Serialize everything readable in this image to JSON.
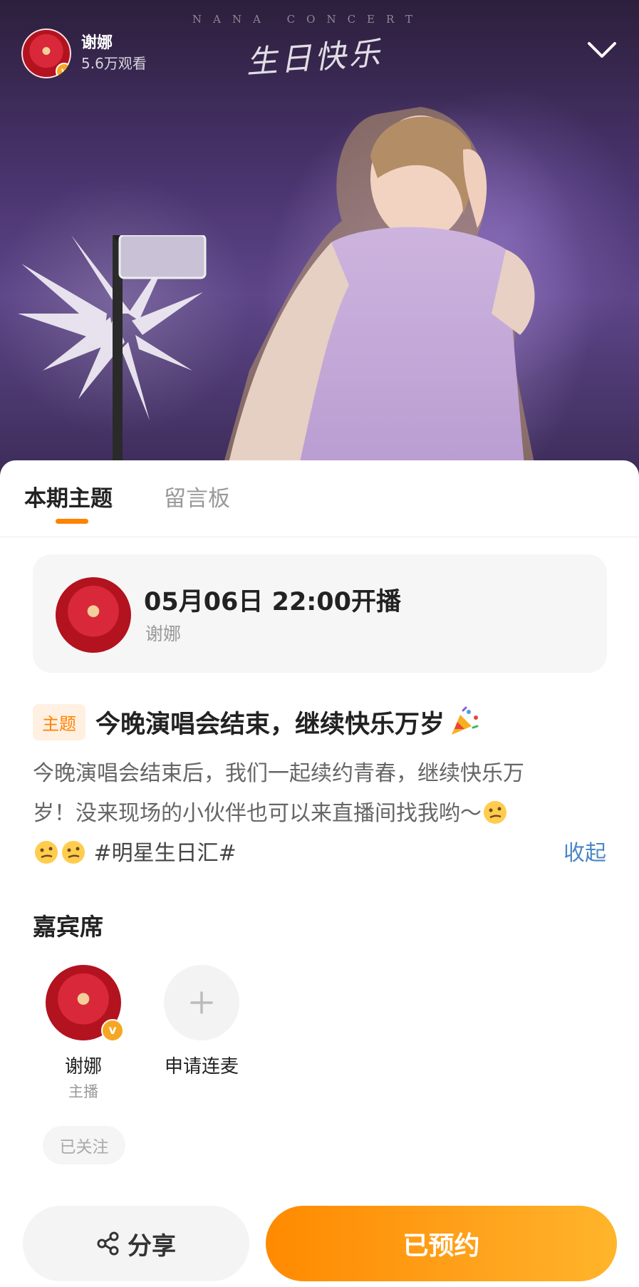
{
  "live": {
    "host_name": "谢娜",
    "viewers": "5.6万观看",
    "poster_title": "生日快乐",
    "poster_subtitle": "NANA CONCERT",
    "collapse_icon": "chevron-down-icon"
  },
  "tabs": [
    {
      "label": "本期主题",
      "active": true
    },
    {
      "label": "留言板",
      "active": false
    }
  ],
  "schedule": {
    "time": "05月06日 22:00开播",
    "host": "谢娜"
  },
  "topic": {
    "badge": "主题",
    "title": "今晚演唱会结束，继续快乐万岁",
    "icon": "party-popper-icon"
  },
  "description": {
    "line1": "今晚演唱会结束后，我们一起续约青春，继续快乐万",
    "line2": "岁！没来现场的小伙伴也可以来直播间找我哟～",
    "hashtag": "#明星生日汇#",
    "collapse": "收起"
  },
  "guests": {
    "heading": "嘉宾席",
    "host": {
      "name": "谢娜",
      "role": "主播",
      "follow_state": "已关注"
    },
    "apply": {
      "label": "申请连麦",
      "icon": "plus-icon"
    }
  },
  "actions": {
    "share": "分享",
    "share_icon": "share-icon",
    "reserve": "已预约"
  },
  "colors": {
    "accent": "#ff8200",
    "link": "#4a86c6",
    "verified": "#f5a623"
  }
}
